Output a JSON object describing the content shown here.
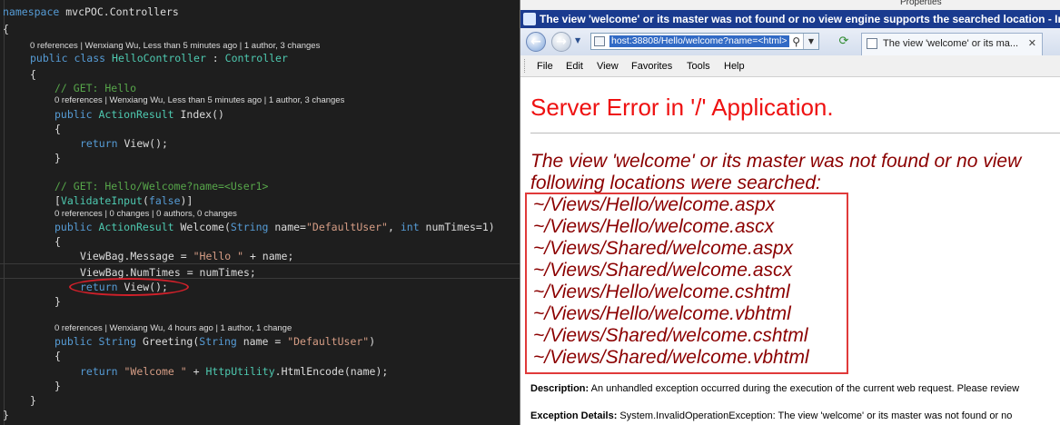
{
  "editor": {
    "lines": [
      {
        "kind": "code",
        "parts": [
          [
            "kw",
            "namespace"
          ],
          [
            "df",
            " mvcPOC.Controllers"
          ]
        ]
      },
      {
        "kind": "code",
        "parts": [
          [
            "df",
            "{"
          ]
        ]
      },
      {
        "kind": "lens",
        "parts": [
          [
            "df",
            "0 references | Wenxiang Wu, Less than 5 minutes ago | 1 author, 3 changes"
          ]
        ]
      },
      {
        "kind": "code",
        "parts": [
          [
            "kw",
            "public class "
          ],
          [
            "ty",
            "HelloController"
          ],
          [
            "df",
            " : "
          ],
          [
            "ty",
            "Controller"
          ]
        ]
      },
      {
        "kind": "code",
        "parts": [
          [
            "df",
            "{"
          ]
        ]
      },
      {
        "kind": "code",
        "parts": [
          [
            "cm",
            "// GET: Hello"
          ]
        ]
      },
      {
        "kind": "lens",
        "parts": [
          [
            "df",
            "0 references | Wenxiang Wu, Less than 5 minutes ago | 1 author, 3 changes"
          ]
        ]
      },
      {
        "kind": "code",
        "parts": [
          [
            "kw",
            "public "
          ],
          [
            "ty",
            "ActionResult"
          ],
          [
            "df",
            " Index()"
          ]
        ]
      },
      {
        "kind": "code",
        "parts": [
          [
            "df",
            "{"
          ]
        ]
      },
      {
        "kind": "code",
        "parts": [
          [
            "kw",
            "return "
          ],
          [
            "df",
            "View();"
          ]
        ]
      },
      {
        "kind": "code",
        "parts": [
          [
            "df",
            "}"
          ]
        ]
      },
      {
        "kind": "code",
        "parts": [
          [
            "cm",
            "// GET: Hello/Welcome?name=<User1>"
          ]
        ]
      },
      {
        "kind": "code",
        "parts": [
          [
            "df",
            "["
          ],
          [
            "ty",
            "ValidateInput"
          ],
          [
            "df",
            "("
          ],
          [
            "kw",
            "false"
          ],
          [
            "df",
            ")]"
          ]
        ]
      },
      {
        "kind": "lens",
        "parts": [
          [
            "df",
            "0 references | 0 changes | 0 authors, 0 changes"
          ]
        ]
      },
      {
        "kind": "code",
        "parts": [
          [
            "kw",
            "public "
          ],
          [
            "ty",
            "ActionResult"
          ],
          [
            "df",
            " Welcome("
          ],
          [
            "kw",
            "String"
          ],
          [
            "df",
            " name="
          ],
          [
            "st",
            "\"DefaultUser\""
          ],
          [
            "df",
            ", "
          ],
          [
            "kw",
            "int"
          ],
          [
            "df",
            " numTimes=1)"
          ]
        ]
      },
      {
        "kind": "code",
        "parts": [
          [
            "df",
            "{"
          ]
        ]
      },
      {
        "kind": "code",
        "parts": [
          [
            "df",
            "ViewBag.Message = "
          ],
          [
            "st",
            "\"Hello \""
          ],
          [
            "df",
            " + name;"
          ]
        ]
      },
      {
        "kind": "code",
        "parts": [
          [
            "df",
            "ViewBag.NumTimes = numTimes;"
          ]
        ]
      },
      {
        "kind": "code",
        "parts": [
          [
            "kw",
            "return "
          ],
          [
            "df",
            "View();"
          ]
        ]
      },
      {
        "kind": "code",
        "parts": [
          [
            "df",
            "}"
          ]
        ]
      },
      {
        "kind": "lens",
        "parts": [
          [
            "df",
            "0 references | Wenxiang Wu, 4 hours ago | 1 author, 1 change"
          ]
        ]
      },
      {
        "kind": "code",
        "parts": [
          [
            "kw",
            "public "
          ],
          [
            "kw",
            "String"
          ],
          [
            "df",
            " Greeting("
          ],
          [
            "kw",
            "String"
          ],
          [
            "df",
            " name = "
          ],
          [
            "st",
            "\"DefaultUser\""
          ],
          [
            "df",
            ")"
          ]
        ]
      },
      {
        "kind": "code",
        "parts": [
          [
            "df",
            "{"
          ]
        ]
      },
      {
        "kind": "code",
        "parts": [
          [
            "kw",
            "return "
          ],
          [
            "st",
            "\"Welcome \""
          ],
          [
            "df",
            " + "
          ],
          [
            "ty",
            "HttpUtility"
          ],
          [
            "df",
            ".HtmlEncode(name);"
          ]
        ]
      },
      {
        "kind": "code",
        "parts": [
          [
            "df",
            "}"
          ]
        ]
      },
      {
        "kind": "code",
        "parts": [
          [
            "df",
            "}"
          ]
        ]
      },
      {
        "kind": "code",
        "parts": [
          [
            "df",
            "}"
          ]
        ]
      }
    ]
  },
  "browser": {
    "title": "The view 'welcome' or its master was not found or no view engine supports the searched location - Int",
    "properties_label": "Properties",
    "address_url": "host:38808/Hello/welcome?name=<html>",
    "tab_label": "The view 'welcome' or its ma...",
    "menu": [
      "File",
      "Edit",
      "View",
      "Favorites",
      "Tools",
      "Help"
    ],
    "page": {
      "heading": "Server Error in '/' Application.",
      "error_line1": "The view 'welcome' or its master was not found or no view",
      "error_line2": "following locations were searched:",
      "locations": [
        "~/Views/Hello/welcome.aspx",
        "~/Views/Hello/welcome.ascx",
        "~/Views/Shared/welcome.aspx",
        "~/Views/Shared/welcome.ascx",
        "~/Views/Hello/welcome.cshtml",
        "~/Views/Hello/welcome.vbhtml",
        "~/Views/Shared/welcome.cshtml",
        "~/Views/Shared/welcome.vbhtml"
      ],
      "description_label": "Description:",
      "description_text": "An unhandled exception occurred during the execution of the current web request. Please review",
      "exception_label": "Exception Details:",
      "exception_text": "System.InvalidOperationException: The view 'welcome' or its master was not found or no"
    }
  }
}
